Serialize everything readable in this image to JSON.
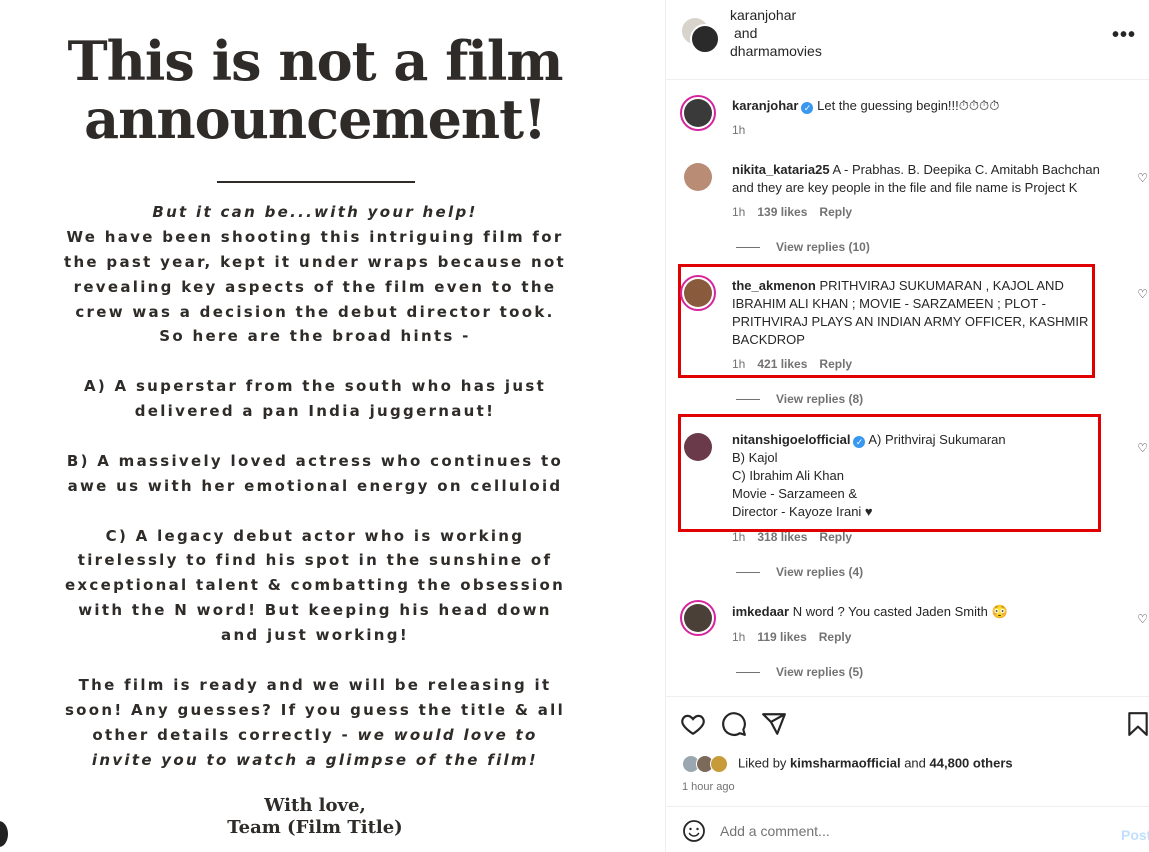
{
  "poster": {
    "title_line1": "This is not a film",
    "title_line2": "announcement!",
    "lines": [
      "But it can be...with your help!",
      "We have been shooting this intriguing film for",
      "the past year, kept it under wraps because not",
      "revealing key aspects of the film even to the",
      "crew was a decision the debut director took.",
      "So here are the broad hints -",
      "",
      "A) A superstar from the south who has just",
      "delivered a pan India juggernaut!",
      "",
      "B) A massively loved actress who continues to",
      "awe us with her emotional energy on celluloid",
      "",
      "C) A legacy debut actor who is working",
      "tirelessly to find his spot in the sunshine of",
      "exceptional talent & combatting the obsession",
      "with the N word! But keeping his head down",
      "and just working!",
      "",
      "The film is ready and we will be releasing it",
      "soon! Any guesses? If you guess the title & all",
      "other details correctly - ",
      "invite you to watch a glimpse of the film!"
    ],
    "line21_italic": "we would love to",
    "sign_line1": "With love,",
    "sign_line2": "Team (Film Title)"
  },
  "header": {
    "user1": "karanjohar",
    "conjunction": "and",
    "user2": "dharmamovies",
    "more_icon": "more-horizontal-icon"
  },
  "caption": {
    "user": "karanjohar",
    "text": "Let the guessing begin!!!⏱⏱⏱⏱",
    "time": "1h"
  },
  "comments": [
    {
      "user": "nikita_kataria25",
      "text": "A - Prabhas. B. Deepika C. Amitabh Bachchan and they are key people in the file and file name is Project K",
      "time": "1h",
      "likes": "139 likes",
      "reply": "Reply",
      "view_replies": "View replies (10)"
    },
    {
      "user": "the_akmenon",
      "text": "PRITHVIRAJ SUKUMARAN , KAJOL AND IBRAHIM ALI KHAN ; MOVIE - SARZAMEEN ; PLOT - PRITHVIRAJ PLAYS AN INDIAN ARMY OFFICER, KASHMIR BACKDROP",
      "time": "1h",
      "likes": "421 likes",
      "reply": "Reply",
      "view_replies": "View replies (8)"
    },
    {
      "user": "nitanshigoelofficial",
      "lines": [
        "A) Prithviraj Sukumaran",
        "B) Kajol",
        "C) Ibrahim Ali Khan",
        "Movie - Sarzameen &",
        "Director - Kayoze Irani ♥"
      ],
      "time": "1h",
      "likes": "318 likes",
      "reply": "Reply",
      "view_replies": "View replies (4)"
    },
    {
      "user": "imkedaar",
      "text": "N word ? You casted Jaden Smith 😳",
      "time": "1h",
      "likes": "119 likes",
      "reply": "Reply",
      "view_replies": "View replies (5)"
    }
  ],
  "liked": {
    "prefix": "Liked by ",
    "user": "kimsharmaofficial",
    "middle": " and ",
    "others": "44,800 others",
    "time_ago": "1 hour ago"
  },
  "add_comment": {
    "placeholder": "Add a comment...",
    "post_label": "Post"
  },
  "colors": {
    "highlight": "#e00000",
    "verified": "#3897f0",
    "post_button": "#c0dffd"
  }
}
